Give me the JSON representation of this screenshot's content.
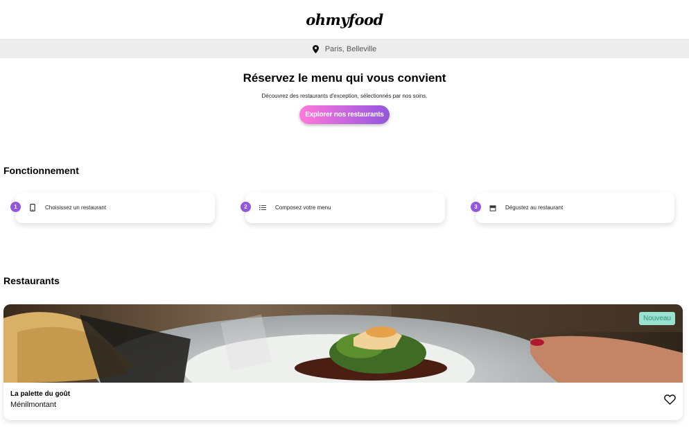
{
  "header": {
    "logo": "ohmyfood"
  },
  "location": {
    "icon": "map-pin-icon",
    "text": "Paris, Belleville"
  },
  "hero": {
    "title": "Réservez le menu qui vous convient",
    "subtitle": "Découvrez des restaurants d'exception, sélectionnés par nos soins.",
    "cta": "Explorer nos restaurants"
  },
  "howto": {
    "title": "Fonctionnement",
    "steps": [
      {
        "number": "1",
        "icon": "phone-icon",
        "label": "Choisissez un restaurant"
      },
      {
        "number": "2",
        "icon": "list-icon",
        "label": "Composez votre menu"
      },
      {
        "number": "3",
        "icon": "store-icon",
        "label": "Dégustez au restaurant"
      }
    ]
  },
  "restaurants": {
    "title": "Restaurants",
    "items": [
      {
        "name": "La palette du goût",
        "location": "Ménilmontant",
        "badge": "Nouveau",
        "favorite_icon": "heart-icon"
      }
    ]
  },
  "colors": {
    "accent_pink": "#ff79da",
    "accent_purple": "#9356dc",
    "badge_bg": "#99e2d0",
    "badge_text": "#368f72"
  }
}
